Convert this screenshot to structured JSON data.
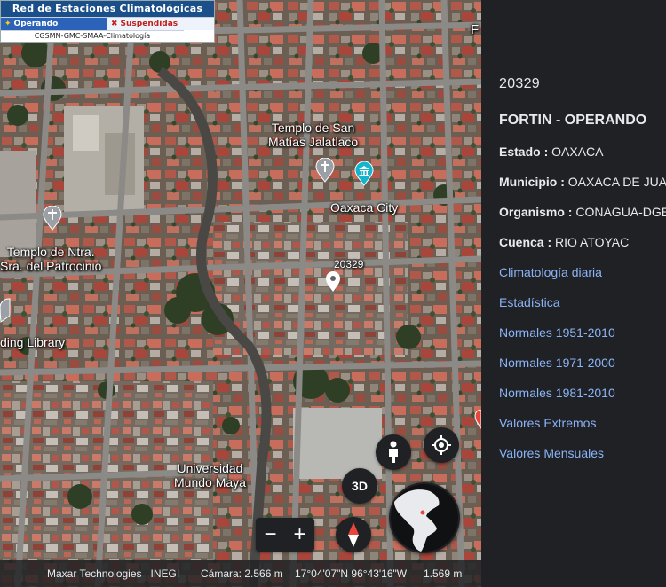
{
  "legend": {
    "title": "Red de Estaciones Climatológicas",
    "operating_label": "Operando",
    "suspended_label": "Suspendidas",
    "credit": "CGSMN-GMC-SMAA-Climatología"
  },
  "map": {
    "edge_label": "F",
    "labels": {
      "templo_san_matias": "Templo de San\nMatías Jalatlaco",
      "oaxaca_city": "Oaxaca City",
      "station_marker": "20329",
      "templo_patrocinio": "Templo de Ntra.\nSra. del Patrocinio",
      "library": "ding Library",
      "universidad": "Universidad\nMundo Maya"
    },
    "controls": {
      "btn_3d": "3D",
      "zoom_out": "−",
      "zoom_in": "+"
    },
    "icons": {
      "church": "church-icon",
      "museum": "museum-icon",
      "pin": "map-pin-icon",
      "pegman": "pegman-icon",
      "location": "my-location-icon",
      "compass": "compass-icon",
      "globe": "globe-icon"
    }
  },
  "statusbar": {
    "attribution": "Maxar Technologies   INEGI",
    "camera": "Cámara: 2.566 m",
    "coords": "17°04'07\"N 96°43'16\"W",
    "elevation": "1.569 m"
  },
  "panel": {
    "station_id": "20329",
    "station_name": "FORTIN - OPERANDO",
    "estado_label": "Estado :",
    "estado_value": " OAXACA",
    "municipio_label": "Municipio :",
    "municipio_value": " OAXACA DE JUAREZ",
    "organismo_label": "Organismo :",
    "organismo_value": " CONAGUA-DGE",
    "cuenca_label": "Cuenca :",
    "cuenca_value": " RIO ATOYAC",
    "links": [
      "Climatología diaria",
      "Estadística",
      "Normales 1951-2010",
      "Normales 1971-2000",
      "Normales 1981-2010",
      "Valores Extremos",
      "Valores Mensuales"
    ]
  },
  "colors": {
    "panel_bg": "#202124",
    "link": "#8ab4f8",
    "legend_header": "#1a4f8a",
    "legend_operating": "#2a63b8",
    "suspended": "#c0201a"
  }
}
